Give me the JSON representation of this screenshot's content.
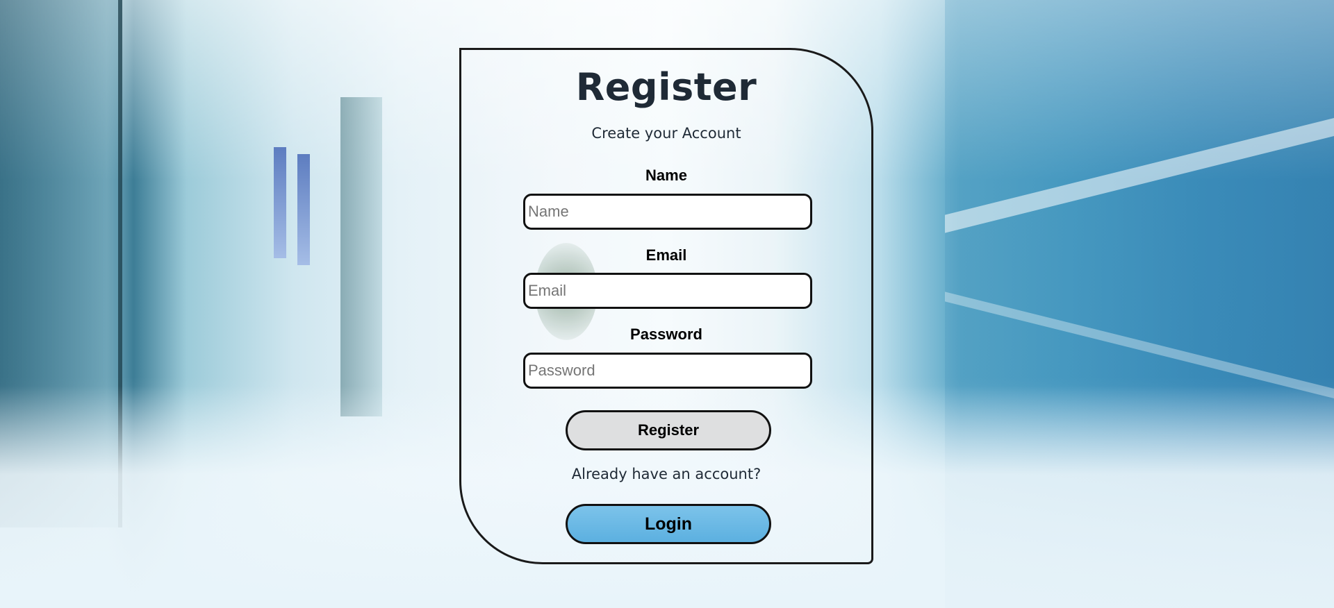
{
  "colors": {
    "card_border": "#1a1a1a",
    "input_background": "#ffffff",
    "register_button": "#dedfe0",
    "login_button": "#6cbbe6",
    "heading_text": "#1f2a36"
  },
  "background": {
    "description_icon": "hospital-corridor-image"
  },
  "card": {
    "title": "Register",
    "subtitle": "Create your Account",
    "fields": {
      "name": {
        "label": "Name",
        "placeholder": "Name",
        "value": ""
      },
      "email": {
        "label": "Email",
        "placeholder": "Email",
        "value": ""
      },
      "password": {
        "label": "Password",
        "placeholder": "Password",
        "value": ""
      }
    },
    "register_button": "Register",
    "already_text": "Already have an account?",
    "login_button": "Login"
  }
}
